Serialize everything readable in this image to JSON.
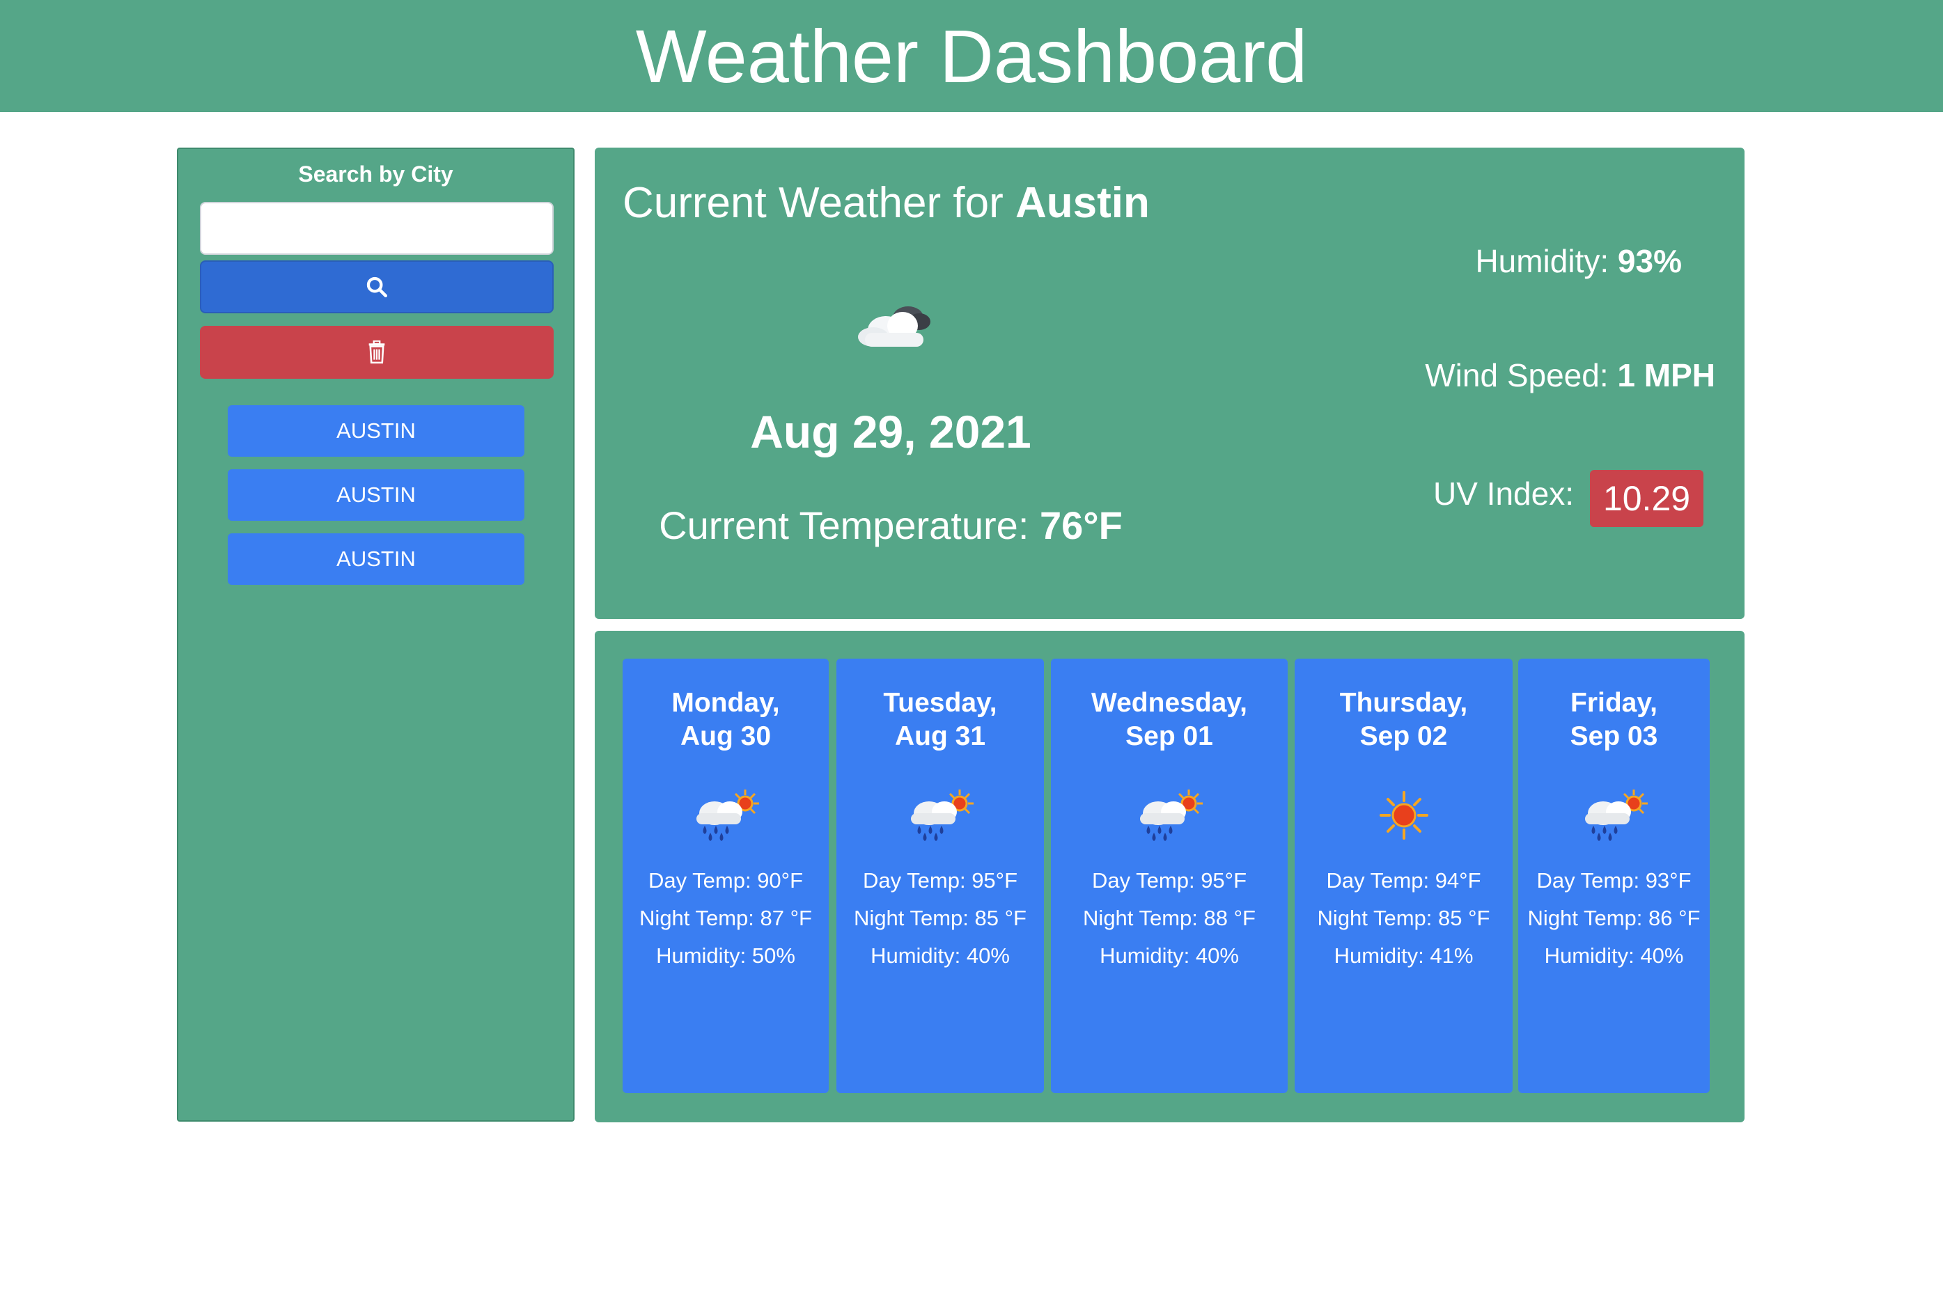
{
  "header": {
    "title": "Weather Dashboard"
  },
  "sidebar": {
    "title": "Search by City",
    "search": {
      "value": "",
      "placeholder": ""
    },
    "history": [
      "AUSTIN",
      "AUSTIN",
      "AUSTIN"
    ]
  },
  "current": {
    "title_prefix": "Current Weather for ",
    "city": "Austin",
    "icon": "partly-cloudy-night-icon",
    "date": "Aug 29, 2021",
    "temp_label": "Current Temperature: ",
    "temp_value": "76°F",
    "humidity_label": "Humidity: ",
    "humidity_value": "93%",
    "wind_label": "Wind Speed: ",
    "wind_value": "1 MPH",
    "uv_label": "UV Index:",
    "uv_value": "10.29"
  },
  "forecast": [
    {
      "day_line1": "Monday,",
      "day_line2": "Aug 30",
      "icon": "sun-rain-cloud-icon",
      "day_temp": "Day Temp: 90°F",
      "night_temp": "Night Temp: 87 °F",
      "humidity": "Humidity: 50%"
    },
    {
      "day_line1": "Tuesday,",
      "day_line2": "Aug 31",
      "icon": "sun-rain-cloud-icon",
      "day_temp": "Day Temp: 95°F",
      "night_temp": "Night Temp: 85 °F",
      "humidity": "Humidity: 40%"
    },
    {
      "day_line1": "Wednesday,",
      "day_line2": "Sep 01",
      "icon": "sun-rain-cloud-icon",
      "day_temp": "Day Temp: 95°F",
      "night_temp": "Night Temp: 88 °F",
      "humidity": "Humidity: 40%"
    },
    {
      "day_line1": "Thursday,",
      "day_line2": "Sep 02",
      "icon": "sun-icon",
      "day_temp": "Day Temp: 94°F",
      "night_temp": "Night Temp: 85 °F",
      "humidity": "Humidity: 41%"
    },
    {
      "day_line1": "Friday,",
      "day_line2": "Sep 03",
      "icon": "sun-rain-cloud-icon",
      "day_temp": "Day Temp: 93°F",
      "night_temp": "Night Temp: 86 °F",
      "humidity": "Humidity: 40%"
    }
  ],
  "colors": {
    "panel": "#55a688",
    "card": "#3a7ef2",
    "search_button": "#2f6bd3",
    "danger": "#c9434b"
  }
}
